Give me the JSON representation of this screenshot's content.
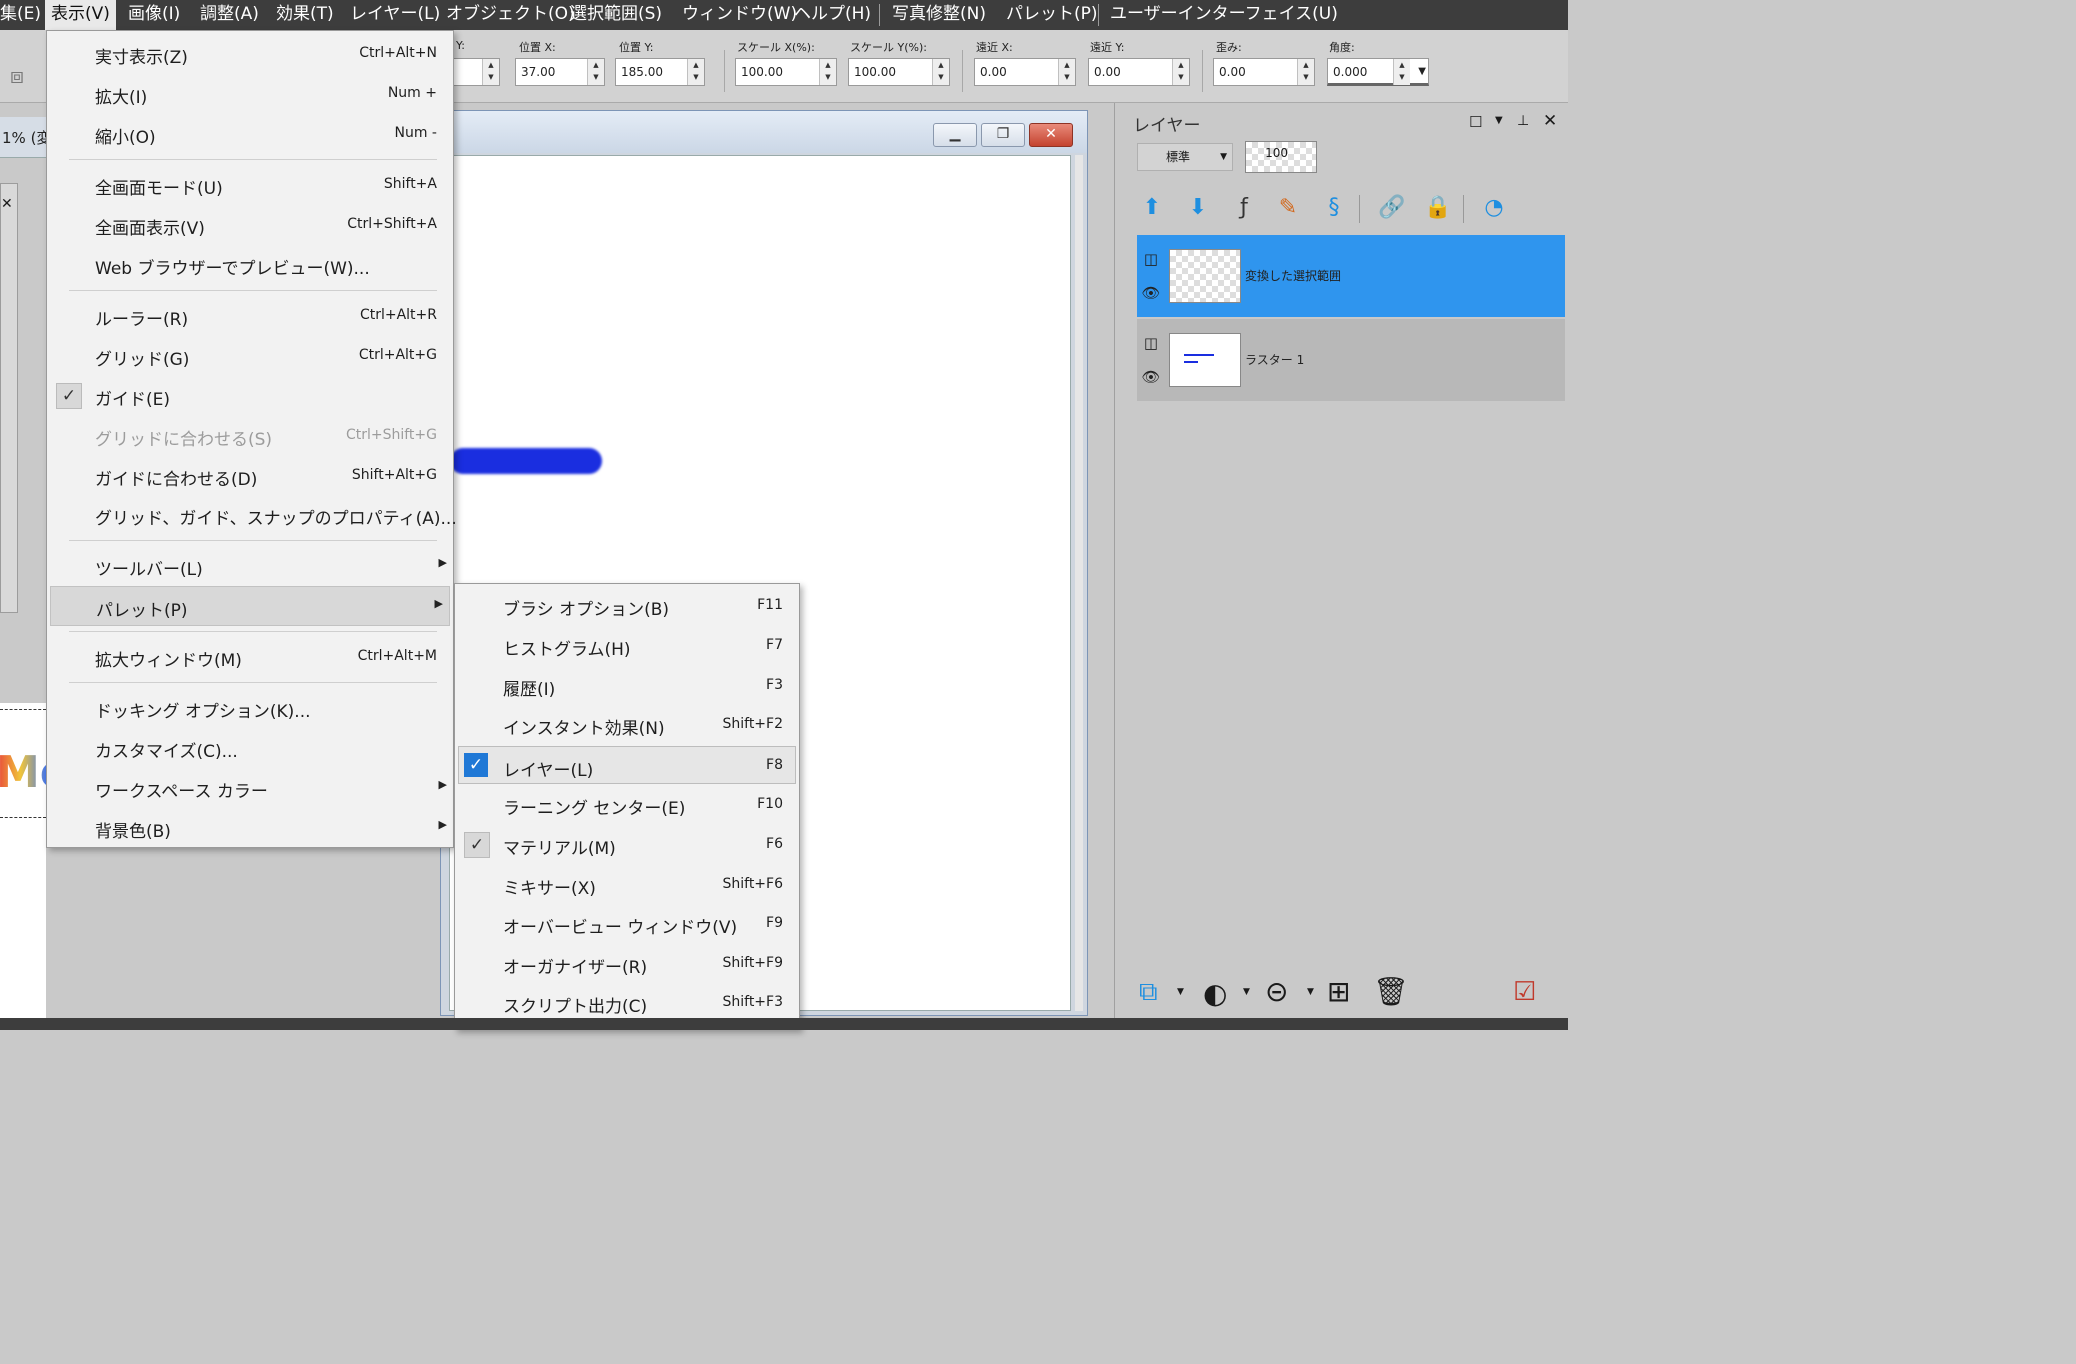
{
  "menubar": {
    "items": [
      "集(E)",
      "表示(V)",
      "画像(I)",
      "調整(A)",
      "効果(T)",
      "レイヤー(L)",
      "オブジェクト(O)",
      "選択範囲(S)",
      "ウィンドウ(W)",
      "ヘルプ(H)",
      "写真修整(N)",
      "パレット(P)",
      "ユーザーインターフェイス(U)"
    ],
    "active": "表示(V)"
  },
  "toolbar": {
    "fields": [
      {
        "label": "Y:",
        "value": ""
      },
      {
        "label": "位置 X:",
        "value": "37.00"
      },
      {
        "label": "位置 Y:",
        "value": "185.00"
      },
      {
        "label": "スケール X(%):",
        "value": "100.00"
      },
      {
        "label": "スケール Y(%):",
        "value": "100.00"
      },
      {
        "label": "遠近 X:",
        "value": "0.00"
      },
      {
        "label": "遠近 Y:",
        "value": "0.00"
      },
      {
        "label": "歪み:",
        "value": "0.00"
      },
      {
        "label": "角度:",
        "value": "0.000"
      }
    ]
  },
  "doc": {
    "zoom_fragment": "1% (変"
  },
  "canvas_text": "Me",
  "view_menu": {
    "items": [
      {
        "label": "実寸表示(Z)",
        "shortcut": "Ctrl+Alt+N"
      },
      {
        "label": "拡大(I)",
        "shortcut": "Num +"
      },
      {
        "label": "縮小(O)",
        "shortcut": "Num -"
      },
      {
        "label": "全画面モード(U)",
        "shortcut": "Shift+A"
      },
      {
        "label": "全画面表示(V)",
        "shortcut": "Ctrl+Shift+A"
      },
      {
        "label": "Web ブラウザーでプレビュー(W)...",
        "shortcut": ""
      },
      {
        "label": "ルーラー(R)",
        "shortcut": "Ctrl+Alt+R"
      },
      {
        "label": "グリッド(G)",
        "shortcut": "Ctrl+Alt+G"
      },
      {
        "label": "ガイド(E)",
        "shortcut": "",
        "checked": true
      },
      {
        "label": "グリッドに合わせる(S)",
        "shortcut": "Ctrl+Shift+G",
        "disabled": true
      },
      {
        "label": "ガイドに合わせる(D)",
        "shortcut": "Shift+Alt+G"
      },
      {
        "label": "グリッド、ガイド、スナップのプロパティ(A)...",
        "shortcut": ""
      },
      {
        "label": "ツールバー(L)",
        "shortcut": "",
        "submenu": true
      },
      {
        "label": "パレット(P)",
        "shortcut": "",
        "submenu": true,
        "highlighted": true
      },
      {
        "label": "拡大ウィンドウ(M)",
        "shortcut": "Ctrl+Alt+M"
      },
      {
        "label": "ドッキング オプション(K)...",
        "shortcut": ""
      },
      {
        "label": "カスタマイズ(C)...",
        "shortcut": ""
      },
      {
        "label": "ワークスペース カラー",
        "shortcut": "",
        "submenu": true
      },
      {
        "label": "背景色(B)",
        "shortcut": "",
        "submenu": true
      }
    ]
  },
  "palette_menu": {
    "items": [
      {
        "label": "ブラシ オプション(B)",
        "shortcut": "F11"
      },
      {
        "label": "ヒストグラム(H)",
        "shortcut": "F7"
      },
      {
        "label": "履歴(I)",
        "shortcut": "F3"
      },
      {
        "label": "インスタント効果(N)",
        "shortcut": "Shift+F2"
      },
      {
        "label": "レイヤー(L)",
        "shortcut": "F8",
        "checked": true,
        "highlighted": true
      },
      {
        "label": "ラーニング センター(E)",
        "shortcut": "F10"
      },
      {
        "label": "マテリアル(M)",
        "shortcut": "F6",
        "checked": true
      },
      {
        "label": "ミキサー(X)",
        "shortcut": "Shift+F6"
      },
      {
        "label": "オーバービュー ウィンドウ(V)",
        "shortcut": "F9"
      },
      {
        "label": "オーガナイザー(R)",
        "shortcut": "Shift+F9"
      },
      {
        "label": "スクリプト出力(C)",
        "shortcut": "Shift+F3"
      }
    ]
  },
  "layers_panel": {
    "title": "レイヤー",
    "blend_mode": "標準",
    "opacity": "100",
    "layers": [
      {
        "name": "変換した選択範囲",
        "selected": true
      },
      {
        "name": "ラスター 1",
        "selected": false
      }
    ]
  },
  "colors": {
    "menubar": "#3d3d3d",
    "accent": "#2f95ee",
    "brush_stroke": "#1a2ee0"
  }
}
